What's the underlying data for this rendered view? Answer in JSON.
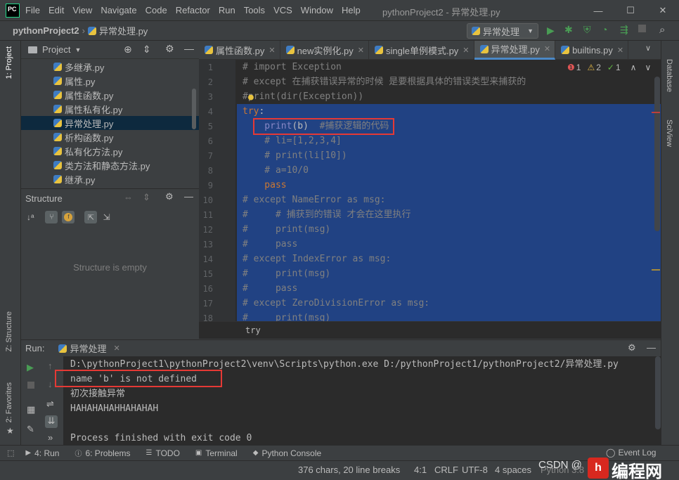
{
  "app": {
    "logo": "PC",
    "title": "pythonProject2 - 异常处理.py"
  },
  "menu": [
    "File",
    "Edit",
    "View",
    "Navigate",
    "Code",
    "Refactor",
    "Run",
    "Tools",
    "VCS",
    "Window",
    "Help"
  ],
  "window_controls": {
    "minimize": "—",
    "maximize": "☐",
    "close": "✕"
  },
  "navbar": {
    "project": "pythonProject2",
    "file": "异常处理.py",
    "run_config": "异常处理"
  },
  "project_panel": {
    "title": "Project",
    "files": [
      "多继承.py",
      "属性.py",
      "属性函数.py",
      "属性私有化.py",
      "异常处理.py",
      "析构函数.py",
      "私有化方法.py",
      "类方法和静态方法.py",
      "继承.py"
    ],
    "selected_index": 4
  },
  "structure_panel": {
    "title": "Structure",
    "empty_text": "Structure is empty"
  },
  "left_tabs": {
    "project": "1: Project",
    "structure": "Z: Structure",
    "favorites": "2: Favorites"
  },
  "right_tabs": {
    "database": "Database",
    "sciview": "SciView"
  },
  "tabs": [
    {
      "label": "属性函数.py",
      "active": false
    },
    {
      "label": "new实例化.py",
      "active": false
    },
    {
      "label": "single单例模式.py",
      "active": false
    },
    {
      "label": "异常处理.py",
      "active": true
    },
    {
      "label": "builtins.py",
      "active": false
    }
  ],
  "inspections": {
    "errors": "1",
    "warnings": "2",
    "weak": "1"
  },
  "code_lines": [
    {
      "n": "1",
      "parts": [
        {
          "t": "# import Exception",
          "c": "c-com"
        }
      ]
    },
    {
      "n": "2",
      "parts": [
        {
          "t": "# except 在捕获错误异常的时候 是要根据具体的错误类型来捕获的",
          "c": "c-com"
        }
      ]
    },
    {
      "n": "3",
      "parts": [
        {
          "t": "#print(dir(Exception))",
          "c": "c-com"
        }
      ]
    },
    {
      "n": "4",
      "parts": [
        {
          "t": "try",
          "c": "c-kw"
        },
        {
          "t": ":",
          "c": ""
        }
      ]
    },
    {
      "n": "5",
      "parts": [
        {
          "t": "    print",
          "c": "c-fn"
        },
        {
          "t": "(b)  ",
          "c": ""
        },
        {
          "t": "#捕获逻辑的代码",
          "c": "c-com"
        }
      ]
    },
    {
      "n": "6",
      "parts": [
        {
          "t": "    # li=[1,2,3,4]",
          "c": "c-com"
        }
      ]
    },
    {
      "n": "7",
      "parts": [
        {
          "t": "    # print(li[10])",
          "c": "c-com"
        }
      ]
    },
    {
      "n": "8",
      "parts": [
        {
          "t": "    # a=10/0",
          "c": "c-com"
        }
      ]
    },
    {
      "n": "9",
      "parts": [
        {
          "t": "    pass",
          "c": "c-kw"
        }
      ]
    },
    {
      "n": "10",
      "parts": [
        {
          "t": "# except NameError as msg:",
          "c": "c-com"
        }
      ]
    },
    {
      "n": "11",
      "parts": [
        {
          "t": "#     # 捕获到的错误 才会在这里执行",
          "c": "c-com"
        }
      ]
    },
    {
      "n": "12",
      "parts": [
        {
          "t": "#     print(msg)",
          "c": "c-com"
        }
      ]
    },
    {
      "n": "13",
      "parts": [
        {
          "t": "#     pass",
          "c": "c-com"
        }
      ]
    },
    {
      "n": "14",
      "parts": [
        {
          "t": "# except IndexError as msg:",
          "c": "c-com"
        }
      ]
    },
    {
      "n": "15",
      "parts": [
        {
          "t": "#     print(msg)",
          "c": "c-com"
        }
      ]
    },
    {
      "n": "16",
      "parts": [
        {
          "t": "#     pass",
          "c": "c-com"
        }
      ]
    },
    {
      "n": "17",
      "parts": [
        {
          "t": "# except ZeroDivisionError as msg:",
          "c": "c-com"
        }
      ]
    },
    {
      "n": "18",
      "parts": [
        {
          "t": "#     print(msg)",
          "c": "c-com"
        }
      ]
    }
  ],
  "editor_breadcrumb": "try",
  "run_panel": {
    "label": "Run:",
    "tab": "异常处理"
  },
  "console": [
    "D:\\pythonProject1\\pythonProject2\\venv\\Scripts\\python.exe D:/pythonProject1/pythonProject2/异常处理.py",
    "name 'b' is not defined",
    "初次接触异常",
    "HAHAHAHAHHAHAHAH",
    "",
    "Process finished with exit code 0"
  ],
  "bottom_tabs": [
    {
      "label": "4: Run",
      "icon": "play-icon"
    },
    {
      "label": "6: Problems",
      "icon": "info-icon"
    },
    {
      "label": "TODO",
      "icon": "list-icon"
    },
    {
      "label": "Terminal",
      "icon": "terminal-icon"
    },
    {
      "label": "Python Console",
      "icon": "python-icon"
    }
  ],
  "event_log": "Event Log",
  "status": {
    "chars": "376 chars, 20 line breaks",
    "pos": "4:1",
    "eol": "CRLF",
    "enc": "UTF-8",
    "indent": "4 spaces",
    "interp": "Python 3.8"
  },
  "watermark": {
    "csdn": "CSDN @",
    "site": "编程网"
  },
  "colors": {
    "accent": "#4a88c7",
    "selection": "#214283",
    "highlight_box": "#e53935"
  }
}
